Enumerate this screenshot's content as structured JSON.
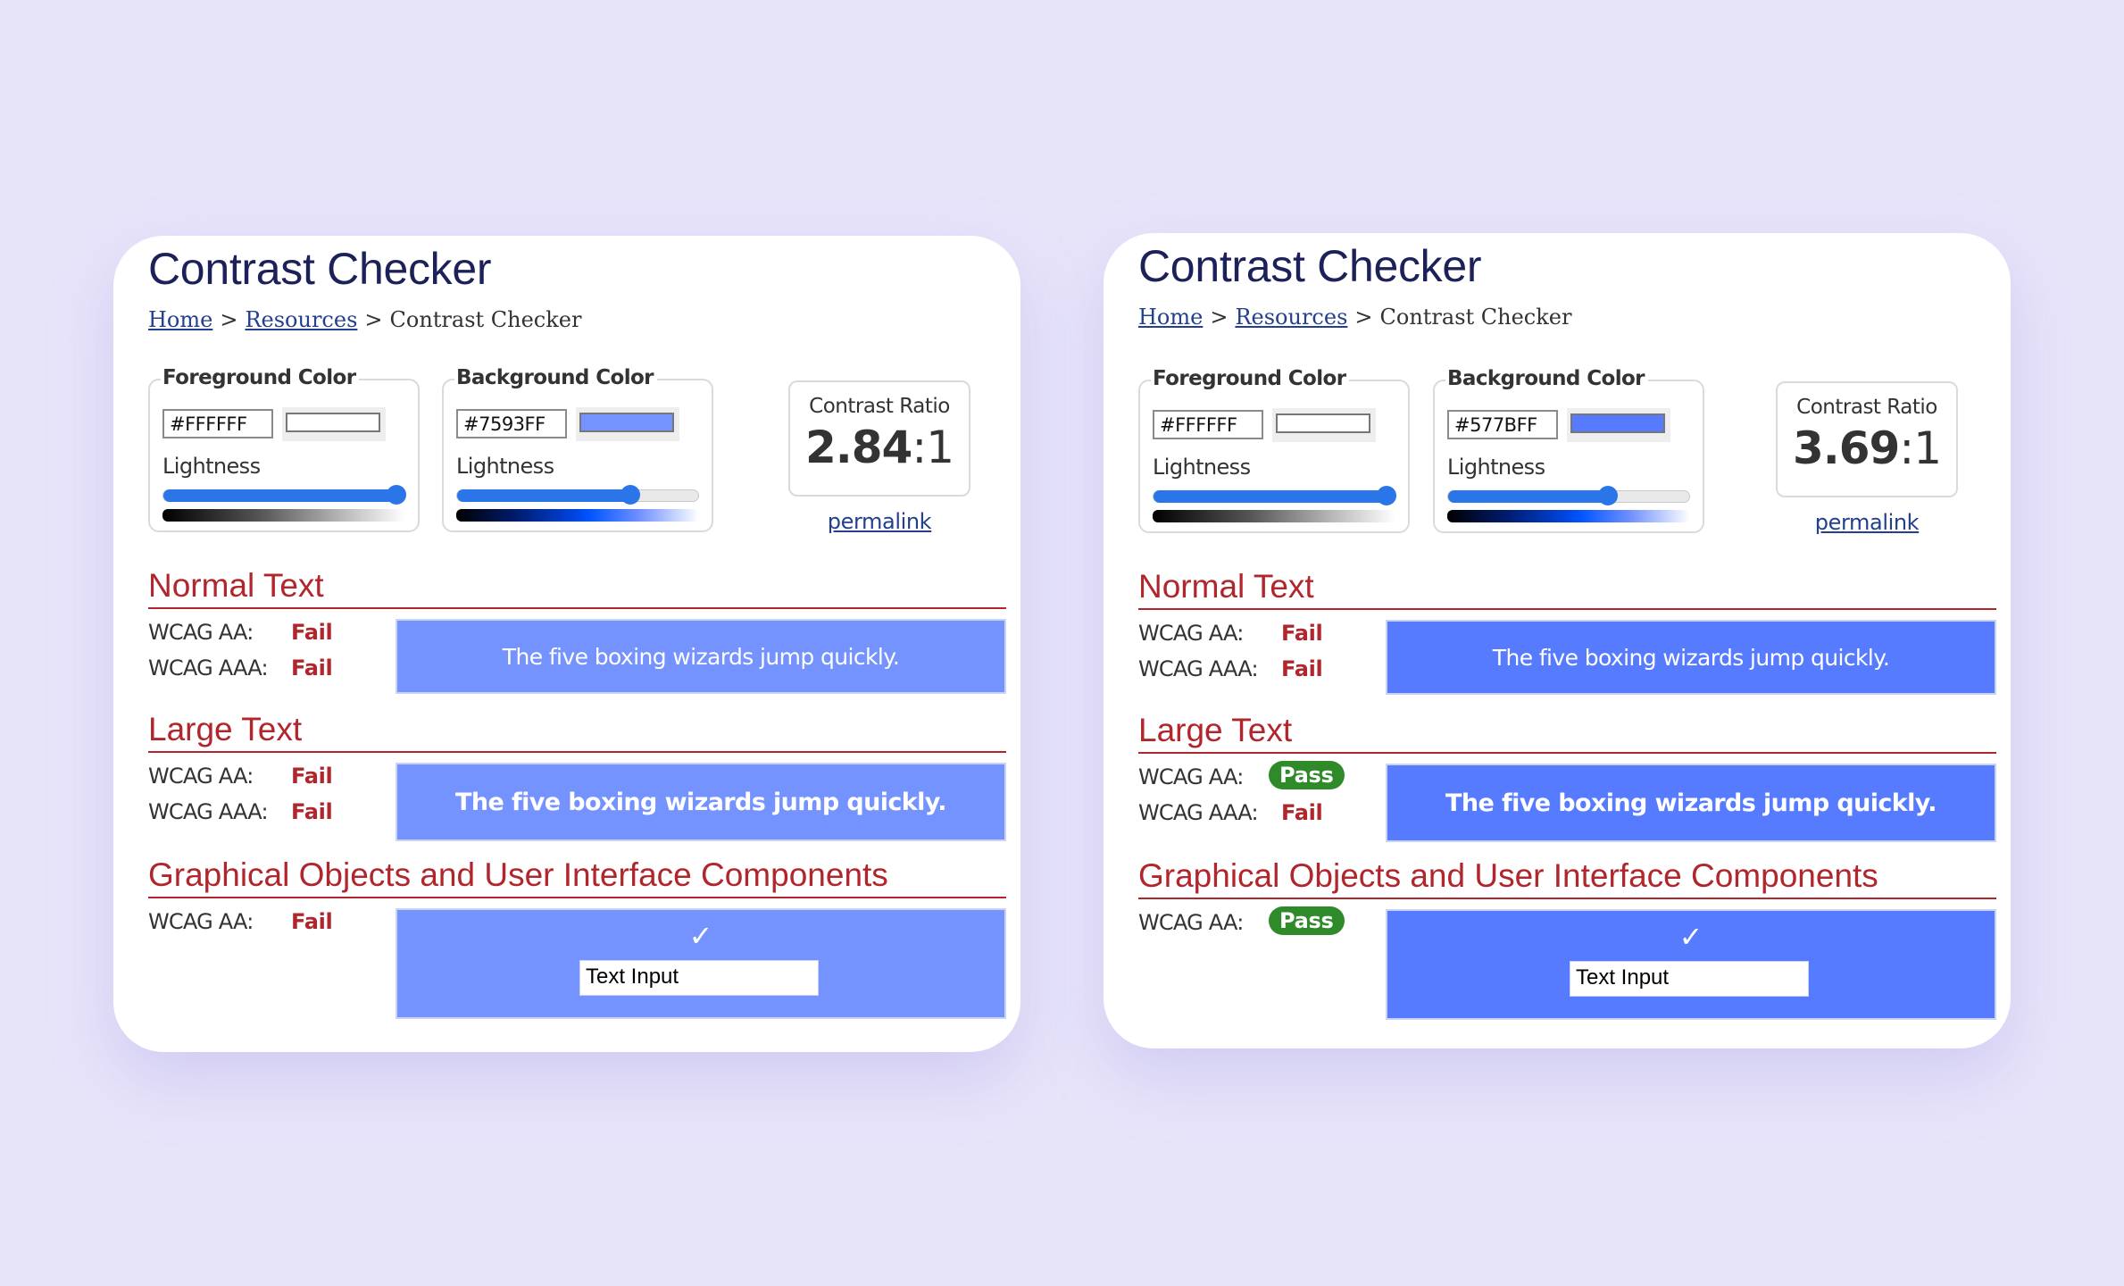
{
  "page": {
    "background": "#E7E4FA"
  },
  "panels": [
    {
      "title": "Contrast Checker",
      "breadcrumb": {
        "home": "Home",
        "sep1": ">",
        "resources": "Resources",
        "sep2": ">",
        "current": "Contrast Checker"
      },
      "foreground": {
        "legend": "Foreground Color",
        "hex": "#FFFFFF",
        "swatch_color": "#FFFFFF",
        "lightness_label": "Lightness",
        "lightness_percent": 100
      },
      "background": {
        "legend": "Background Color",
        "hex": "#7593FF",
        "swatch_color": "#7593FF",
        "lightness_label": "Lightness",
        "lightness_percent": 73
      },
      "contrast": {
        "label": "Contrast Ratio",
        "value": "2.84",
        "suffix": ":1"
      },
      "permalink": "permalink",
      "normal_text": {
        "heading": "Normal Text",
        "aa_label": "WCAG AA:",
        "aa_result": "Fail",
        "aaa_label": "WCAG AAA:",
        "aaa_result": "Fail",
        "sample": "The five boxing wizards jump quickly."
      },
      "large_text": {
        "heading": "Large Text",
        "aa_label": "WCAG AA:",
        "aa_result": "Fail",
        "aaa_label": "WCAG AAA:",
        "aaa_result": "Fail",
        "sample": "The five boxing wizards jump quickly."
      },
      "graphics": {
        "heading": "Graphical Objects and User Interface Components",
        "aa_label": "WCAG AA:",
        "aa_result": "Fail",
        "check_glyph": "✓",
        "input_value": "Text Input"
      }
    },
    {
      "title": "Contrast Checker",
      "breadcrumb": {
        "home": "Home",
        "sep1": ">",
        "resources": "Resources",
        "sep2": ">",
        "current": "Contrast Checker"
      },
      "foreground": {
        "legend": "Foreground Color",
        "hex": "#FFFFFF",
        "swatch_color": "#FFFFFF",
        "lightness_label": "Lightness",
        "lightness_percent": 100
      },
      "background": {
        "legend": "Background Color",
        "hex": "#577BFF",
        "swatch_color": "#577BFF",
        "lightness_label": "Lightness",
        "lightness_percent": 67
      },
      "contrast": {
        "label": "Contrast Ratio",
        "value": "3.69",
        "suffix": ":1"
      },
      "permalink": "permalink",
      "normal_text": {
        "heading": "Normal Text",
        "aa_label": "WCAG AA:",
        "aa_result": "Fail",
        "aaa_label": "WCAG AAA:",
        "aaa_result": "Fail",
        "sample": "The five boxing wizards jump quickly."
      },
      "large_text": {
        "heading": "Large Text",
        "aa_label": "WCAG AA:",
        "aa_result": "Pass",
        "aaa_label": "WCAG AAA:",
        "aaa_result": "Fail",
        "sample": "The five boxing wizards jump quickly."
      },
      "graphics": {
        "heading": "Graphical Objects and User Interface Components",
        "aa_label": "WCAG AA:",
        "aa_result": "Pass",
        "check_glyph": "✓",
        "input_value": "Text Input"
      }
    }
  ],
  "colors": {
    "pass": "#2F8A2A",
    "fail": "#B0262C",
    "heading": "#1C2159",
    "link": "#23408E",
    "slider": "#2A76E8"
  }
}
